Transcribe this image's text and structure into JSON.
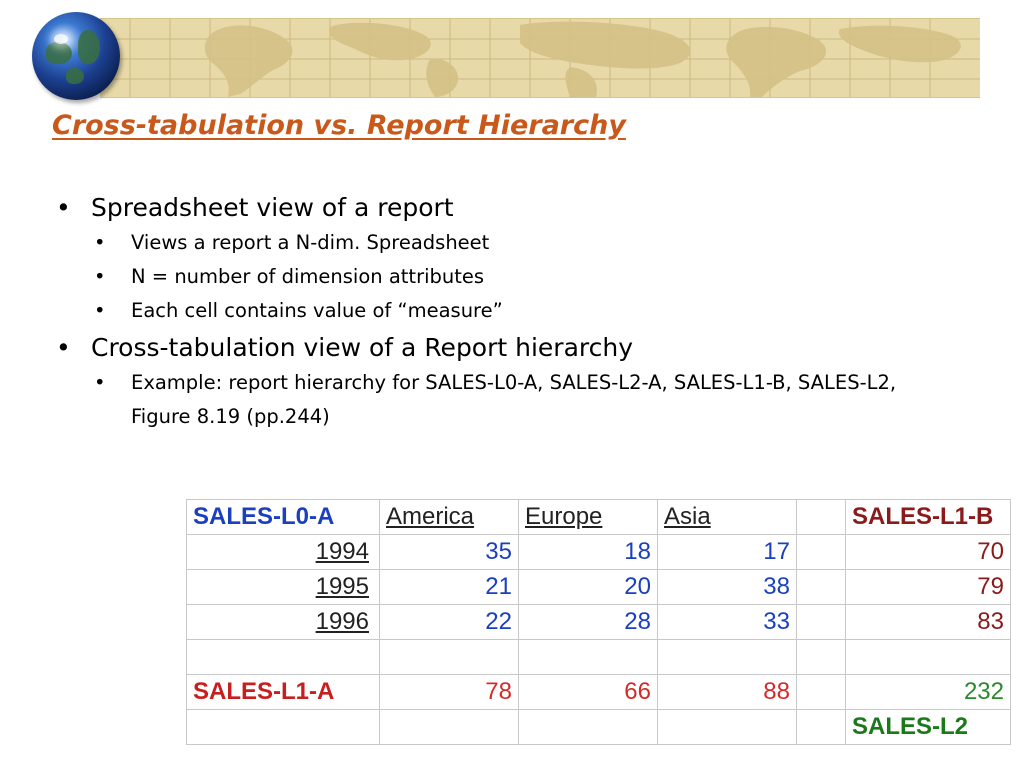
{
  "slide": {
    "title": "Cross-tabulation vs. Report Hierarchy",
    "bullets": [
      {
        "text": "Spreadsheet view of a report",
        "sub": [
          "Views a report a N-dim. Spreadsheet",
          "N = number of dimension attributes",
          "Each cell contains value of “measure”"
        ]
      },
      {
        "text": "Cross-tabulation view of a Report hierarchy",
        "sub": [
          "Example: report hierarchy for SALES-L0-A, SALES-L2-A, SALES-L1-B, SALES-L2, Figure 8.19 (pp.244)"
        ]
      }
    ]
  },
  "table": {
    "corner": "SALES-L0-A",
    "columns": [
      "America",
      "Europe",
      "Asia",
      ""
    ],
    "row_total_label": "SALES-L1-B",
    "rows": [
      {
        "year": "1994",
        "values": [
          "35",
          "18",
          "17"
        ],
        "total": "70"
      },
      {
        "year": "1995",
        "values": [
          "21",
          "20",
          "38"
        ],
        "total": "79"
      },
      {
        "year": "1996",
        "values": [
          "22",
          "28",
          "33"
        ],
        "total": "83"
      }
    ],
    "col_total_label": "SALES-L1-A",
    "col_totals": [
      "78",
      "66",
      "88"
    ],
    "grand_total": "232",
    "grand_total_label": "SALES-L2"
  },
  "colors": {
    "title": "#c8591a",
    "banner": "#e8d9a8",
    "blue": "#1a3fbf",
    "red": "#d42a2a",
    "green": "#2b8a2b"
  },
  "icons": [
    "globe-icon",
    "world-map-banner"
  ]
}
